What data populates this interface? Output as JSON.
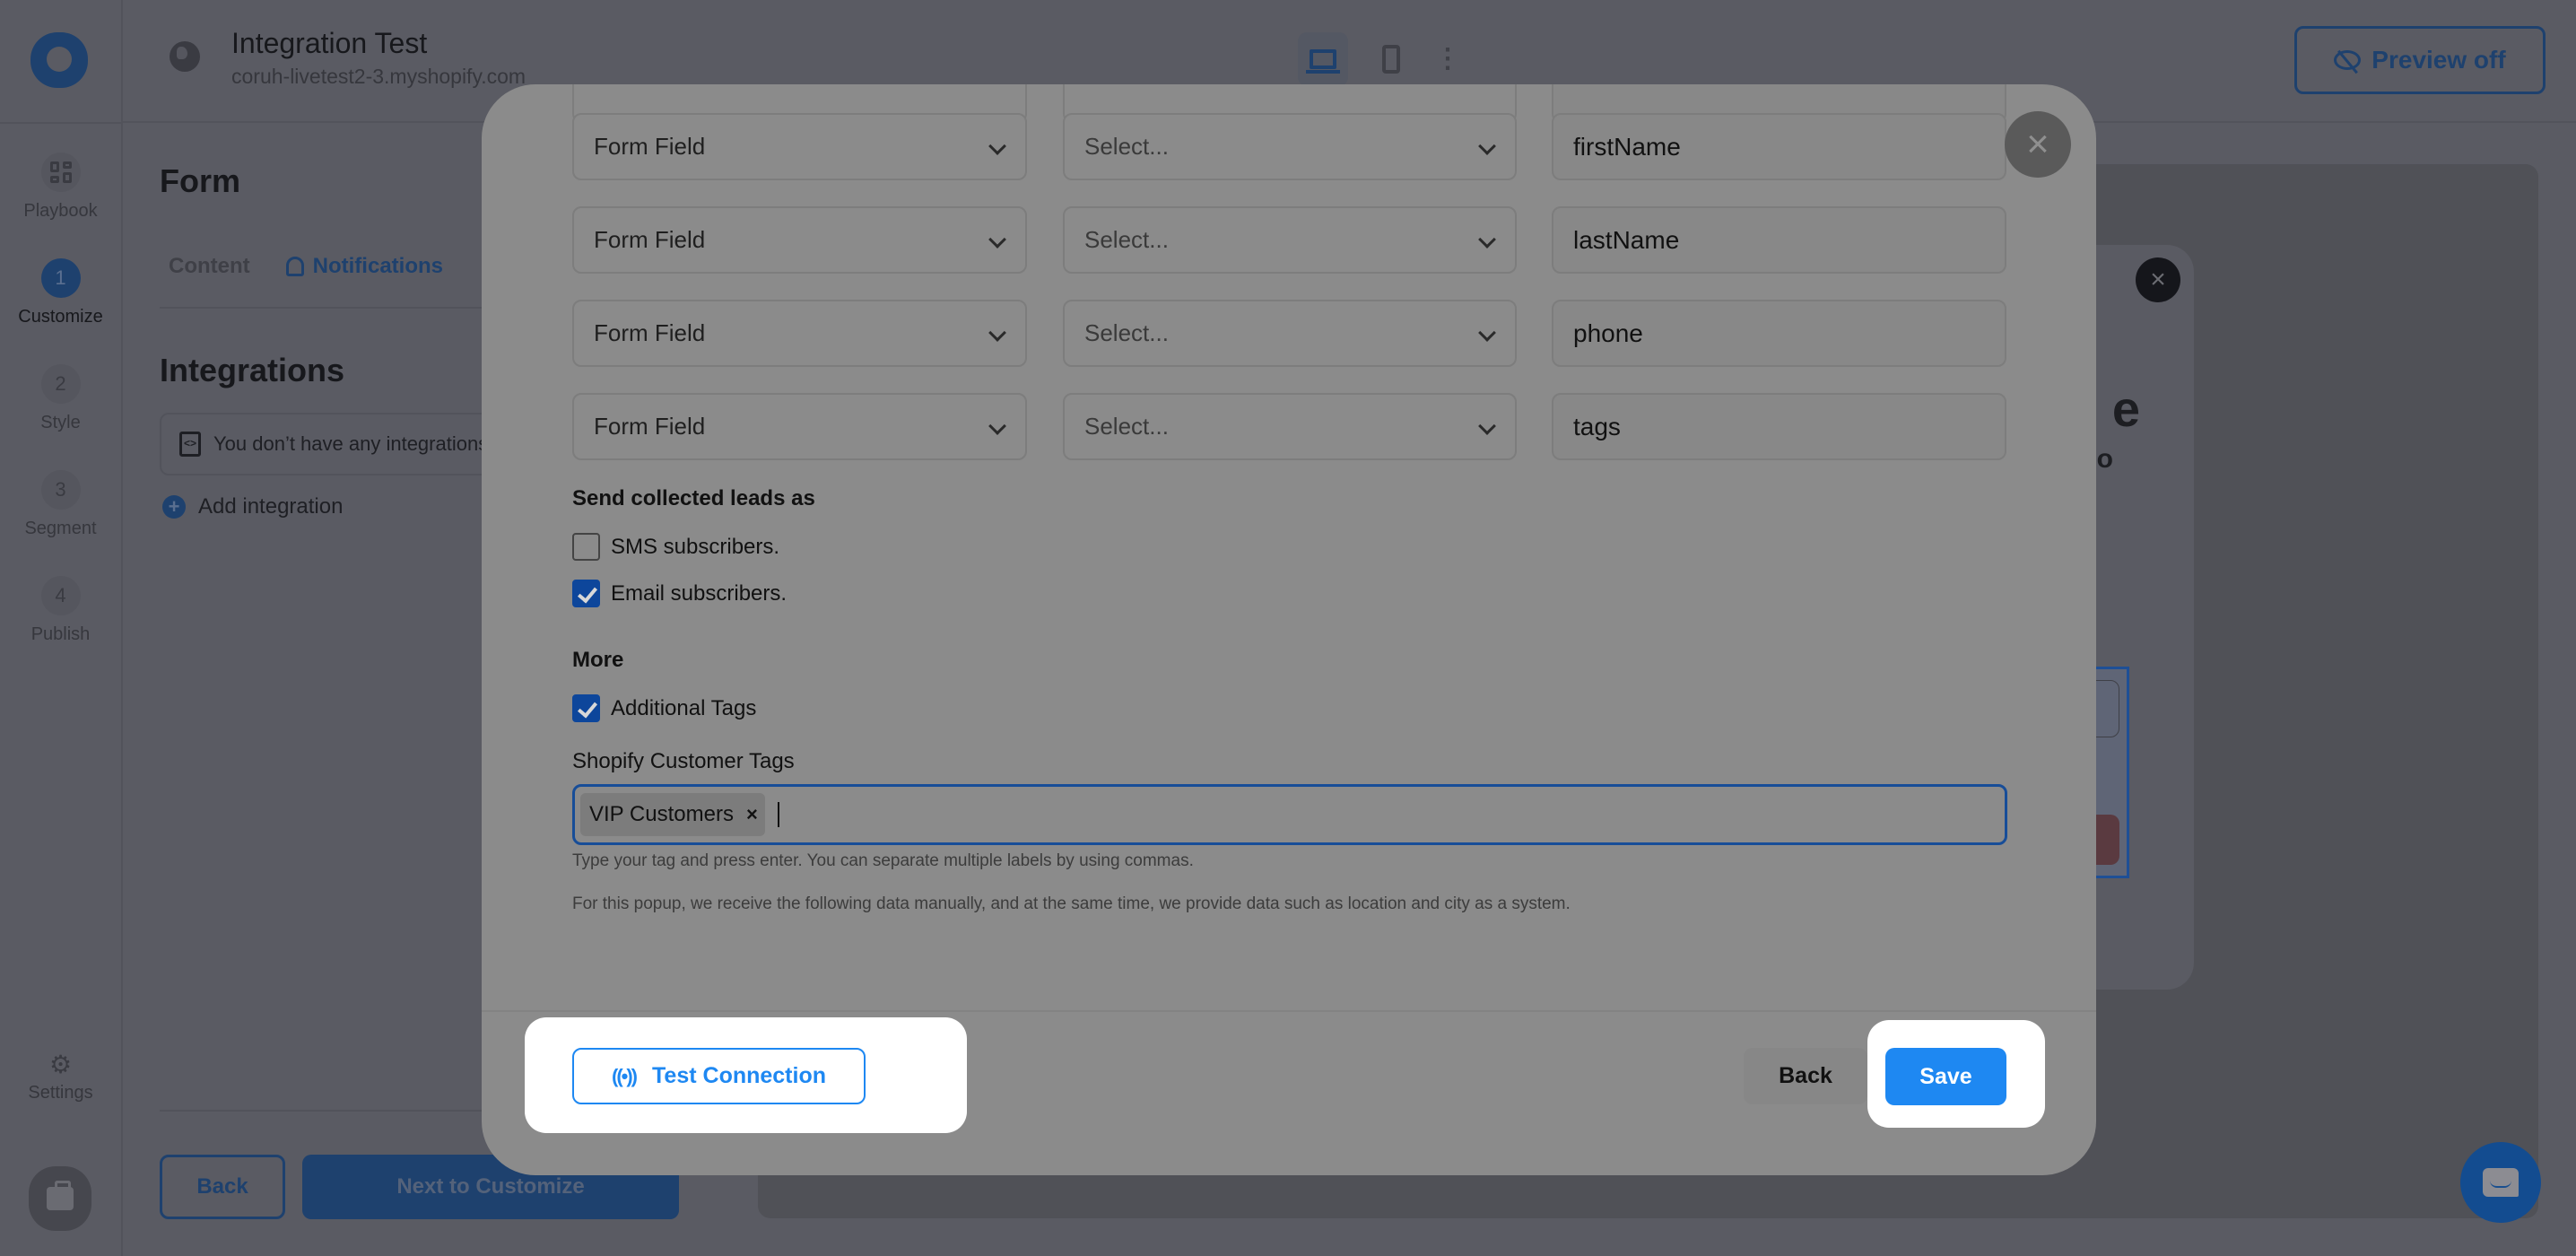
{
  "app": {
    "store_title": "Integration Test",
    "store_url": "coruh-livetest2-3.myshopify.com",
    "preview_button": "Preview off"
  },
  "sidebar": {
    "items": [
      {
        "label": "Playbook",
        "icon": "grid-icon"
      },
      {
        "label": "Customize",
        "step": "1",
        "active": true
      },
      {
        "label": "Style",
        "step": "2"
      },
      {
        "label": "Segment",
        "step": "3"
      },
      {
        "label": "Publish",
        "step": "4"
      }
    ],
    "settings_label": "Settings"
  },
  "left_panel": {
    "title": "Form",
    "tabs": [
      {
        "label": "Content",
        "active": false
      },
      {
        "label": "Notifications",
        "active": true
      }
    ],
    "integrations_title": "Integrations",
    "empty_message": "You don’t have any integrations",
    "add_integration": "Add integration",
    "back_button": "Back",
    "next_button": "Next to Customize"
  },
  "modal": {
    "mapping_rows": [
      {
        "source": "Form Field",
        "target_placeholder": "Select...",
        "field_value": "firstName"
      },
      {
        "source": "Form Field",
        "target_placeholder": "Select...",
        "field_value": "lastName"
      },
      {
        "source": "Form Field",
        "target_placeholder": "Select...",
        "field_value": "phone"
      },
      {
        "source": "Form Field",
        "target_placeholder": "Select...",
        "field_value": "tags"
      }
    ],
    "send_leads_title": "Send collected leads as",
    "options": [
      {
        "label": "SMS subscribers.",
        "checked": false
      },
      {
        "label": "Email subscribers.",
        "checked": true
      }
    ],
    "more_title": "More",
    "additional_tags": {
      "label": "Additional Tags",
      "checked": true
    },
    "tags_label": "Shopify Customer Tags",
    "tags": [
      "VIP Customers"
    ],
    "tags_remove_glyph": "×",
    "tags_hint": "Type your tag and press enter. You can separate multiple labels by using commas.",
    "info_text": "For this popup, we receive the following data manually, and at the same time, we provide data such as location and city as a system.",
    "test_button": "Test Connection",
    "back_button": "Back",
    "save_button": "Save",
    "close_glyph": "×"
  },
  "colors": {
    "accent": "#1e88f2",
    "checkbox": "#0d469b",
    "overlay_modal": "#8b8b8b",
    "backdrop": "#5a5b63"
  }
}
